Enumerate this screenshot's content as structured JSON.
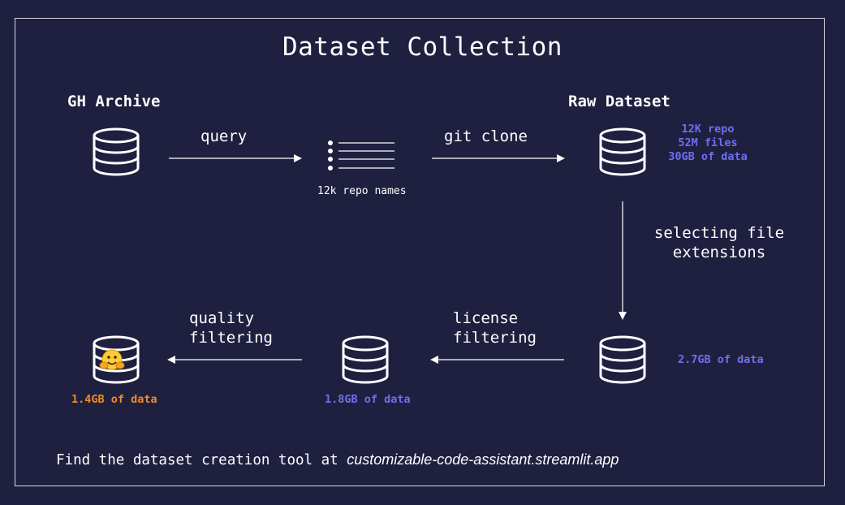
{
  "title": "Dataset Collection",
  "nodes": {
    "gh_archive": {
      "label": "GH Archive"
    },
    "repo_list": {
      "caption": "12k repo names"
    },
    "raw_dataset": {
      "label": "Raw Dataset",
      "stats": [
        "12K repo",
        "52M files",
        "30GB of data"
      ]
    },
    "extension_filtered": {
      "stats": "2.7GB of data"
    },
    "license_filtered": {
      "stats": "1.8GB of data"
    },
    "quality_filtered": {
      "stats": "1.4GB of data",
      "icon": "hugging-face-emoji"
    }
  },
  "edges": {
    "query": "query",
    "git_clone": "git clone",
    "selecting_extensions": [
      "selecting file",
      "extensions"
    ],
    "license_filtering": [
      "license",
      "filtering"
    ],
    "quality_filtering": [
      "quality",
      "filtering"
    ]
  },
  "footer": {
    "prefix": "Find the dataset creation tool at",
    "url": "customizable-code-assistant.streamlit.app"
  },
  "colors": {
    "background": "#1f2040",
    "foreground": "#ffffff",
    "stat_blue": "#6f6ef0",
    "stat_orange": "#f08a24"
  }
}
